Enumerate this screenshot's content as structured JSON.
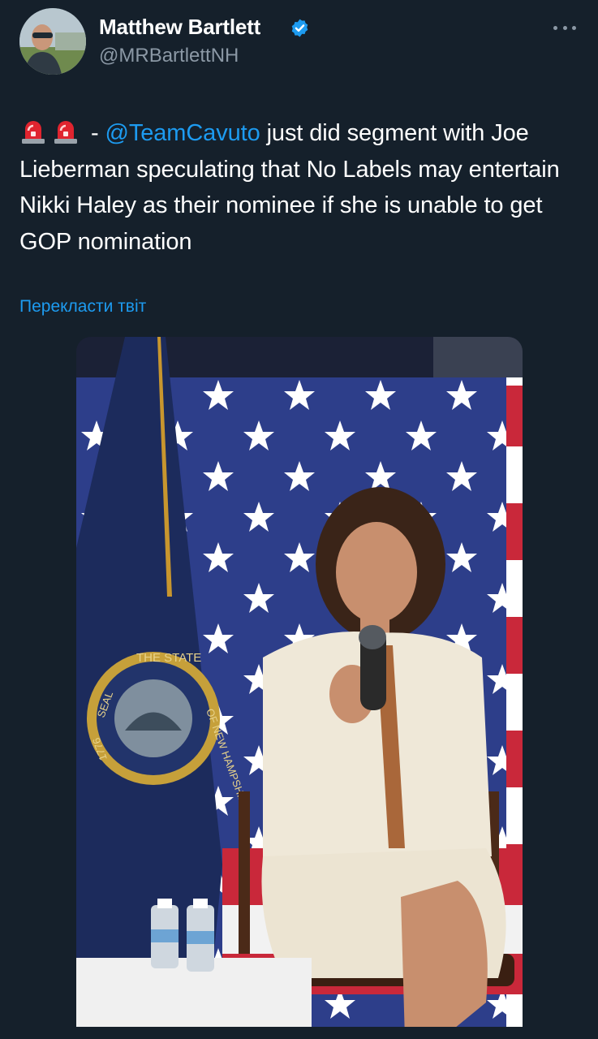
{
  "author": {
    "display_name": "Matthew Bartlett",
    "handle": "@MRBartlettNH",
    "verified": true,
    "avatar_icon": "avatar-photo"
  },
  "tweet": {
    "emoji_1": "siren-icon",
    "emoji_2": "siren-icon",
    "text_before": " - ",
    "mention": "@TeamCavuto",
    "text_after": " just did segment with Joe Lieberman speculating that No Labels may entertain Nikki Haley as their nominee if she is unable to get GOP nomination"
  },
  "translate_label": "Перекласти твіт",
  "colors": {
    "background": "#15202b",
    "link": "#1d9bf0",
    "secondary_text": "#8b98a5",
    "verified_badge": "#1d9bf0"
  },
  "icons": [
    "verified-badge-icon",
    "more-options-icon",
    "siren-icon"
  ],
  "photo": {
    "seal_top_text": "THE STATE",
    "seal_right_text": "OF NEW HAMPSHIRE",
    "seal_left_text": "SEAL",
    "seal_year": "1776"
  }
}
